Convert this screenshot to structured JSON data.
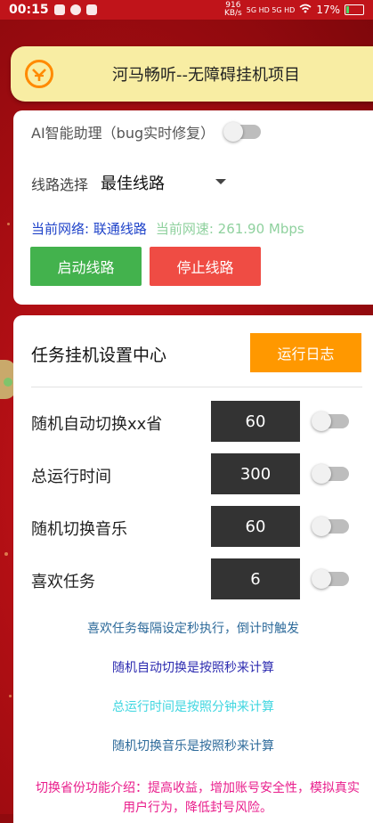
{
  "status_bar": {
    "time": "00:15",
    "net_rate": "916",
    "net_unit": "KB/s",
    "signal": "5G HD 5G HD",
    "battery": "17%"
  },
  "header": {
    "title": "河马畅听--无障碍挂机项目"
  },
  "route_card": {
    "ai_label": "AI智能助理（bug实时修复）",
    "ai_enabled": false,
    "route_label": "线路选择",
    "route_value": "最佳线路",
    "network_label": "当前网络: 联通线路",
    "speed_label": "当前网速: 261.90 Mbps",
    "start_button": "启动线路",
    "stop_button": "停止线路"
  },
  "task_card": {
    "title": "任务挂机设置中心",
    "log_button": "运行日志",
    "tasks": [
      {
        "label": "随机自动切换xx省",
        "value": "60",
        "enabled": false
      },
      {
        "label": "总运行时间",
        "value": "300",
        "enabled": false
      },
      {
        "label": "随机切换音乐",
        "value": "60",
        "enabled": false
      },
      {
        "label": "喜欢任务",
        "value": "6",
        "enabled": false
      }
    ],
    "notes": [
      {
        "text": "喜欢任务每隔设定秒执行，倒计时触发",
        "color": "#2d6a9a"
      },
      {
        "text": "随机自动切换是按照秒来计算",
        "color": "#2c2bb0"
      },
      {
        "text": "总运行时间是按照分钟来计算",
        "color": "#3fd6e0"
      },
      {
        "text": "随机切换音乐是按照秒来计算",
        "color": "#2d6a9a"
      }
    ],
    "intro": "切换省份功能介绍：提高收益，增加账号安全性，模拟真实用户行为，降低封号风险。"
  },
  "colors": {
    "background": "#a80d12",
    "banner": "#f8eda3",
    "start": "#43b24d",
    "stop": "#ef4c44",
    "log": "#ff9800",
    "intro": "#e91e8c"
  }
}
